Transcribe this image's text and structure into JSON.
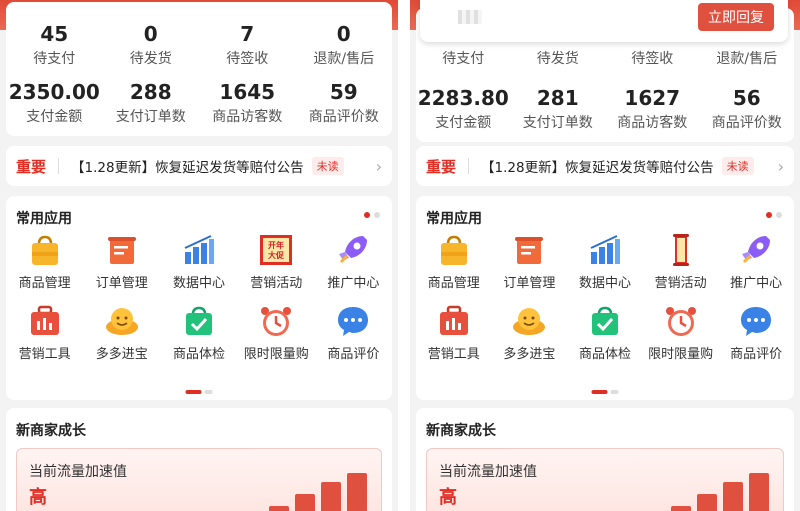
{
  "panels": [
    {
      "stats_row1": [
        {
          "value": "45",
          "label": "待支付"
        },
        {
          "value": "0",
          "label": "待发货"
        },
        {
          "value": "7",
          "label": "待签收"
        },
        {
          "value": "0",
          "label": "退款/售后"
        }
      ],
      "stats_row2": [
        {
          "value": "2350.00",
          "label": "支付金额"
        },
        {
          "value": "288",
          "label": "支付订单数"
        },
        {
          "value": "1645",
          "label": "商品访客数"
        },
        {
          "value": "59",
          "label": "商品评价数"
        }
      ],
      "notice": {
        "tag": "重要",
        "text": "【1.28更新】恢复延迟发货等赔付公告",
        "badge": "未读"
      },
      "apps_title": "常用应用",
      "apps": [
        {
          "label": "商品管理",
          "icon": "shopping-bag-icon"
        },
        {
          "label": "订单管理",
          "icon": "order-list-icon"
        },
        {
          "label": "数据中心",
          "icon": "bar-chart-icon"
        },
        {
          "label": "营销活动",
          "icon": "new-year-promo-icon",
          "icon_text": "开年大促"
        },
        {
          "label": "推广中心",
          "icon": "rocket-icon"
        },
        {
          "label": "营销工具",
          "icon": "toolbox-icon"
        },
        {
          "label": "多多进宝",
          "icon": "gold-ingot-icon"
        },
        {
          "label": "商品体检",
          "icon": "check-bag-icon"
        },
        {
          "label": "限时限量购",
          "icon": "alarm-clock-icon"
        },
        {
          "label": "商品评价",
          "icon": "chat-bubble-icon"
        }
      ],
      "growth_title": "新商家成长",
      "growth_label": "当前流量加速值",
      "growth_level": "高",
      "growth_bars": [
        0.12,
        0.35,
        0.55,
        0.75,
        0.9
      ]
    },
    {
      "popup_button": "立即回复",
      "stats_row1": [
        {
          "value": "",
          "label": "待支付"
        },
        {
          "value": "",
          "label": "待发货"
        },
        {
          "value": "",
          "label": "待签收"
        },
        {
          "value": "",
          "label": "退款/售后"
        }
      ],
      "stats_row2": [
        {
          "value": "2283.80",
          "label": "支付金额"
        },
        {
          "value": "281",
          "label": "支付订单数"
        },
        {
          "value": "1627",
          "label": "商品访客数"
        },
        {
          "value": "56",
          "label": "商品评价数"
        }
      ],
      "notice": {
        "tag": "重要",
        "text": "【1.28更新】恢复延迟发货等赔付公告",
        "badge": "未读"
      },
      "apps_title": "常用应用",
      "apps": [
        {
          "label": "商品管理",
          "icon": "shopping-bag-icon"
        },
        {
          "label": "订单管理",
          "icon": "order-list-icon"
        },
        {
          "label": "数据中心",
          "icon": "bar-chart-icon"
        },
        {
          "label": "营销活动",
          "icon": "promo-scroll-icon"
        },
        {
          "label": "推广中心",
          "icon": "rocket-icon"
        },
        {
          "label": "营销工具",
          "icon": "toolbox-icon"
        },
        {
          "label": "多多进宝",
          "icon": "gold-ingot-icon"
        },
        {
          "label": "商品体检",
          "icon": "check-bag-icon"
        },
        {
          "label": "限时限量购",
          "icon": "alarm-clock-icon"
        },
        {
          "label": "商品评价",
          "icon": "chat-bubble-icon"
        }
      ],
      "growth_title": "新商家成长",
      "growth_label": "当前流量加速值",
      "growth_level": "高",
      "growth_bars": [
        0.12,
        0.35,
        0.55,
        0.75,
        0.9
      ]
    }
  ]
}
